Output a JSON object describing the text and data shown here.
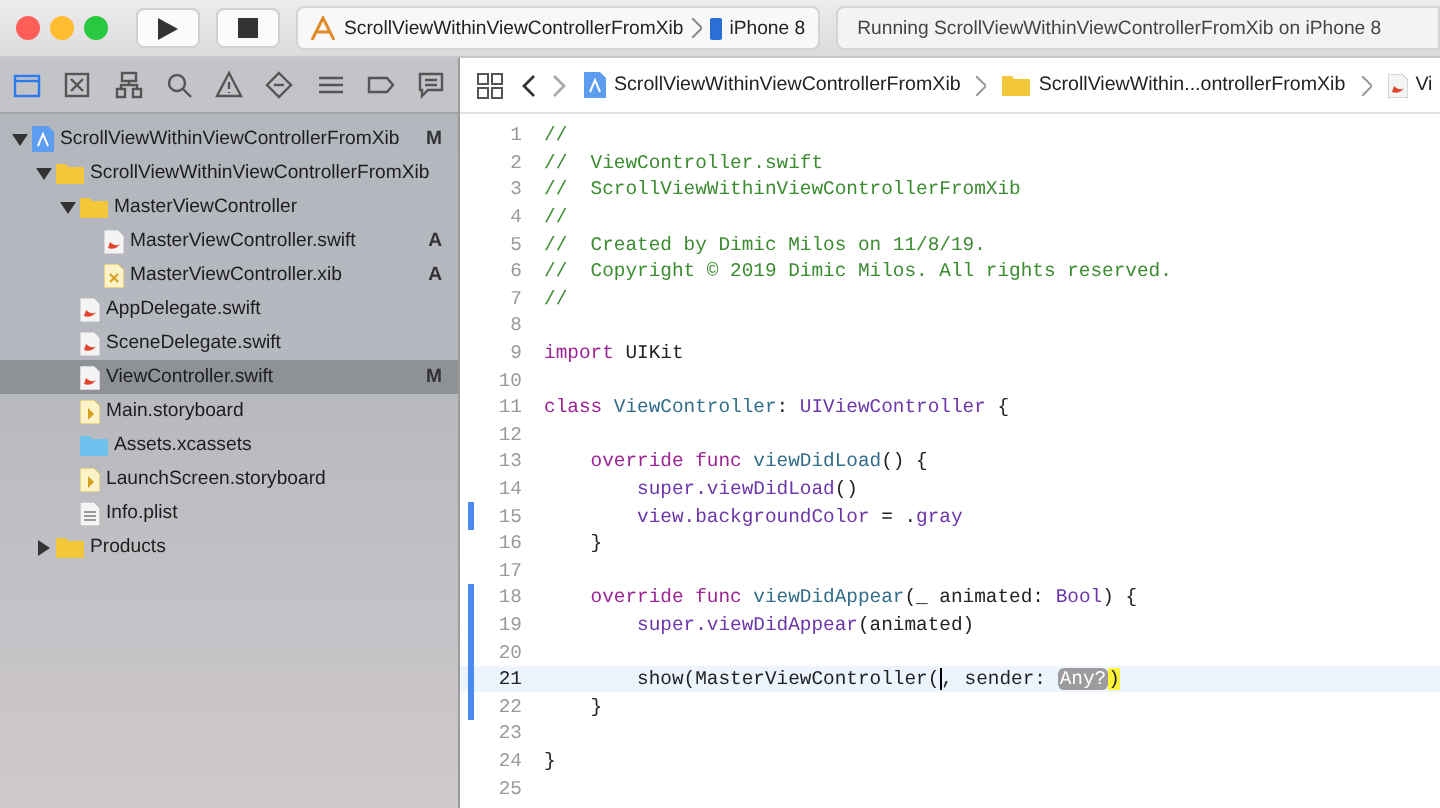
{
  "toolbar": {
    "scheme": "ScrollViewWithinViewControllerFromXib",
    "device": "iPhone 8",
    "activity": "Running ScrollViewWithinViewControllerFromXib on iPhone 8"
  },
  "navigator_tabs": [
    {
      "kind": "folder",
      "selected": true
    },
    {
      "kind": "source",
      "selected": false
    },
    {
      "kind": "hierarchy",
      "selected": false
    },
    {
      "kind": "search",
      "selected": false
    },
    {
      "kind": "issue",
      "selected": false
    },
    {
      "kind": "test",
      "selected": false
    },
    {
      "kind": "debug",
      "selected": false
    },
    {
      "kind": "breakpoint",
      "selected": false
    },
    {
      "kind": "report",
      "selected": false
    }
  ],
  "tree": [
    {
      "name": "ScrollViewWithinViewControllerFromXib",
      "kind": "project",
      "status": "M",
      "selected": false,
      "expanded": true,
      "children": [
        {
          "name": "ScrollViewWithinViewControllerFromXib",
          "kind": "folder",
          "selected": false,
          "expanded": true,
          "children": [
            {
              "name": "MasterViewController",
              "kind": "folder",
              "selected": false,
              "expanded": true,
              "children": [
                {
                  "name": "MasterViewController.swift",
                  "kind": "swift",
                  "status": "A",
                  "selected": false
                },
                {
                  "name": "MasterViewController.xib",
                  "kind": "xib",
                  "status": "A",
                  "selected": false
                }
              ]
            },
            {
              "name": "AppDelegate.swift",
              "kind": "swift",
              "selected": false
            },
            {
              "name": "SceneDelegate.swift",
              "kind": "swift",
              "selected": false
            },
            {
              "name": "ViewController.swift",
              "kind": "swift",
              "status": "M",
              "selected": true
            },
            {
              "name": "Main.storyboard",
              "kind": "storyboard",
              "selected": false
            },
            {
              "name": "Assets.xcassets",
              "kind": "assets",
              "selected": false
            },
            {
              "name": "LaunchScreen.storyboard",
              "kind": "storyboard",
              "selected": false
            },
            {
              "name": "Info.plist",
              "kind": "plist",
              "selected": false
            }
          ]
        },
        {
          "name": "Products",
          "kind": "folder",
          "selected": false,
          "expanded": false
        }
      ]
    }
  ],
  "breadcrumbs": [
    {
      "text": "ScrollViewWithinViewControllerFromXib",
      "kind": "project"
    },
    {
      "text": "ScrollViewWithin...ontrollerFromXib",
      "kind": "folder"
    },
    {
      "text": "Vi",
      "kind": "swift"
    }
  ],
  "code": [
    {
      "number": "1",
      "changed": false,
      "current": false,
      "segments": [
        {
          "kind": "comment",
          "text": "//"
        }
      ]
    },
    {
      "number": "2",
      "changed": false,
      "current": false,
      "segments": [
        {
          "kind": "comment",
          "text": "//  ViewController.swift"
        }
      ]
    },
    {
      "number": "3",
      "changed": false,
      "current": false,
      "segments": [
        {
          "kind": "comment",
          "text": "//  ScrollViewWithinViewControllerFromXib"
        }
      ]
    },
    {
      "number": "4",
      "changed": false,
      "current": false,
      "segments": [
        {
          "kind": "comment",
          "text": "//"
        }
      ]
    },
    {
      "number": "5",
      "changed": false,
      "current": false,
      "segments": [
        {
          "kind": "comment",
          "text": "//  Created by Dimic Milos on 11/8/19."
        }
      ]
    },
    {
      "number": "6",
      "changed": false,
      "current": false,
      "segments": [
        {
          "kind": "comment",
          "text": "//  Copyright © 2019 Dimic Milos. All rights reserved."
        }
      ]
    },
    {
      "number": "7",
      "changed": false,
      "current": false,
      "segments": [
        {
          "kind": "comment",
          "text": "//"
        }
      ]
    },
    {
      "number": "8",
      "changed": false,
      "current": false
    },
    {
      "number": "9",
      "changed": false,
      "current": false,
      "segments": [
        {
          "kind": "keyword",
          "text": "import"
        },
        {
          "kind": "plain",
          "text": " UIKit"
        }
      ]
    },
    {
      "number": "10",
      "changed": false,
      "current": false
    },
    {
      "number": "11",
      "changed": false,
      "current": false,
      "segments": [
        {
          "kind": "keyword",
          "text": "class"
        },
        {
          "kind": "decl",
          "text": " ViewController"
        },
        {
          "kind": "plain",
          "text": ": "
        },
        {
          "kind": "type",
          "text": "UIViewController"
        },
        {
          "kind": "plain",
          "text": " {"
        }
      ]
    },
    {
      "number": "12",
      "changed": false,
      "current": false
    },
    {
      "number": "13",
      "changed": false,
      "current": false,
      "segments": [
        {
          "kind": "keyword",
          "text": "    override func"
        },
        {
          "kind": "decl",
          "text": " viewDidLoad"
        },
        {
          "kind": "plain",
          "text": "() {"
        }
      ]
    },
    {
      "number": "14",
      "changed": false,
      "current": false,
      "segments": [
        {
          "kind": "type",
          "text": "        super.viewDidLoad"
        },
        {
          "kind": "plain",
          "text": "()"
        }
      ]
    },
    {
      "number": "15",
      "changed": true,
      "current": false,
      "segments": [
        {
          "kind": "type",
          "text": "        view.backgroundColor"
        },
        {
          "kind": "plain",
          "text": " = ."
        },
        {
          "kind": "type",
          "text": "gray"
        }
      ]
    },
    {
      "number": "16",
      "changed": false,
      "current": false,
      "segments": [
        {
          "kind": "plain",
          "text": "    }"
        }
      ]
    },
    {
      "number": "17",
      "changed": false,
      "current": false
    },
    {
      "number": "18",
      "changed": true,
      "current": false,
      "segments": [
        {
          "kind": "keyword",
          "text": "    override func"
        },
        {
          "kind": "decl",
          "text": " viewDidAppear"
        },
        {
          "kind": "plain",
          "text": "(_ animated: "
        },
        {
          "kind": "type",
          "text": "Bool"
        },
        {
          "kind": "plain",
          "text": ") {"
        }
      ]
    },
    {
      "number": "19",
      "changed": true,
      "current": false,
      "segments": [
        {
          "kind": "type",
          "text": "        super.viewDidAppear"
        },
        {
          "kind": "plain",
          "text": "(animated)"
        }
      ]
    },
    {
      "number": "20",
      "changed": true,
      "current": false
    },
    {
      "number": "21",
      "changed": true,
      "current": true,
      "segments": [
        {
          "kind": "plain",
          "text": "        show(MasterViewController("
        },
        {
          "kind": "cursor"
        },
        {
          "kind": "plain",
          "text": ", sender: "
        },
        {
          "kind": "placeholder",
          "text": "Any?"
        },
        {
          "kind": "match",
          "text": ")"
        }
      ]
    },
    {
      "number": "22",
      "changed": true,
      "current": false,
      "segments": [
        {
          "kind": "plain",
          "text": "    }"
        }
      ]
    },
    {
      "number": "23",
      "changed": false,
      "current": false
    },
    {
      "number": "24",
      "changed": false,
      "current": false,
      "segments": [
        {
          "kind": "plain",
          "text": "}"
        }
      ]
    },
    {
      "number": "25",
      "changed": false,
      "current": false
    }
  ]
}
